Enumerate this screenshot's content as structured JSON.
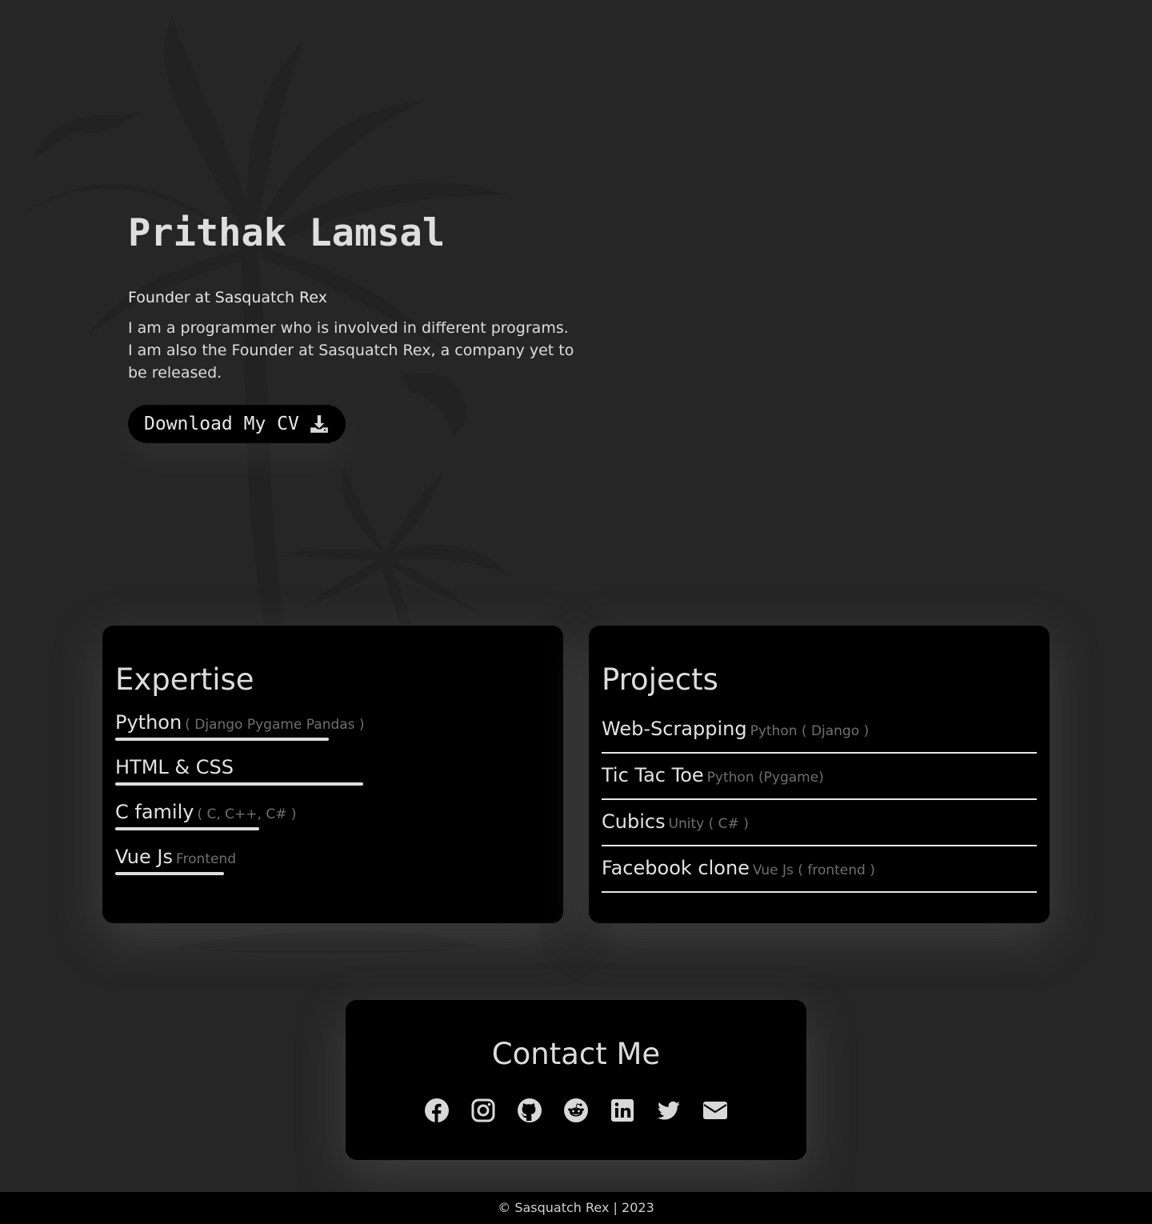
{
  "hero": {
    "name": "Prithak Lamsal",
    "role": "Founder at Sasquatch Rex",
    "bio": "I am a programmer who is involved in different programs. I am also the Founder at Sasquatch Rex, a company yet to be released.",
    "cv_button": "Download My CV"
  },
  "expertise": {
    "title": "Expertise",
    "skills": [
      {
        "name": "Python",
        "sub": "( Django Pygame Pandas )",
        "level": 0.49
      },
      {
        "name": "HTML & CSS",
        "sub": "",
        "level": 0.57
      },
      {
        "name": "C family",
        "sub": "( C, C++, C# )",
        "level": 0.33
      },
      {
        "name": "Vue Js",
        "sub": "Frontend",
        "level": 0.25
      }
    ]
  },
  "projects": {
    "title": "Projects",
    "items": [
      {
        "name": "Web-Scrapping",
        "sub": "Python ( Django )"
      },
      {
        "name": "Tic Tac Toe",
        "sub": "Python (Pygame)"
      },
      {
        "name": "Cubics",
        "sub": "Unity ( C# )"
      },
      {
        "name": "Facebook clone",
        "sub": "Vue Js ( frontend )"
      }
    ]
  },
  "contact": {
    "title": "Contact Me",
    "icons": [
      "facebook-icon",
      "instagram-icon",
      "github-icon",
      "reddit-icon",
      "linkedin-icon",
      "twitter-icon",
      "email-icon"
    ]
  },
  "footer": {
    "text": "© Sasquatch Rex | 2023"
  },
  "colors": {
    "background": "#262626",
    "card": "#000000",
    "text": "#d6d6d6",
    "muted": "#6f6f6f"
  }
}
